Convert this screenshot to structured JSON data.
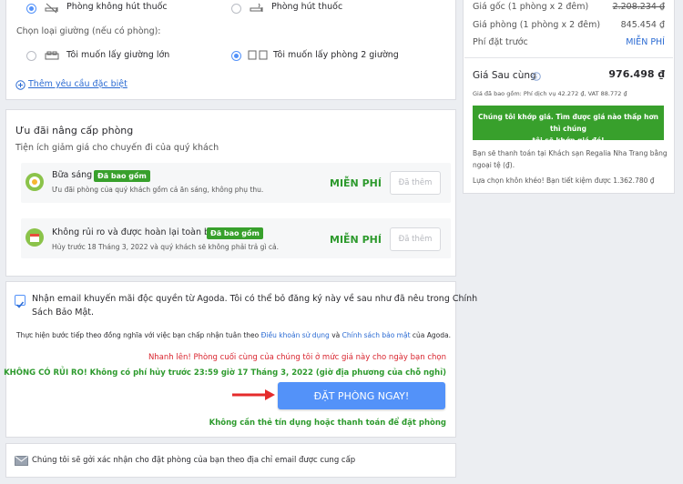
{
  "room_prefs": {
    "smoking_options": [
      {
        "label": "Phòng không hút thuốc",
        "selected": true
      },
      {
        "label": "Phòng hút thuốc",
        "selected": false
      }
    ],
    "bed_title": "Chọn loại giường (nếu có phòng):",
    "bed_options": [
      {
        "label": "Tôi muốn lấy giường lớn",
        "selected": false
      },
      {
        "label": "Tôi muốn lấy phòng 2 giường",
        "selected": true
      }
    ],
    "special_request": "Thêm yêu cầu đặc biệt"
  },
  "upgrades": {
    "title": "Ưu đãi nâng cấp phòng",
    "subtitle": "Tiện ích giảm giá cho chuyến đi của quý khách",
    "items": [
      {
        "name": "Bữa sáng",
        "badge": "Đã bao gồm",
        "desc": "Ưu đãi phòng của quý khách gồm cả ăn sáng, không phụ thu.",
        "price": "MIỄN PHÍ",
        "button": "Đã thêm"
      },
      {
        "name": "Không rủi ro và được hoàn lại toàn bộ",
        "badge": "Đã bao gồm",
        "desc": "Hủy trước 18 Tháng 3, 2022 và quý khách sẽ không phải trả gì cả.",
        "price": "MIỄN PHÍ",
        "button": "Đã thêm"
      }
    ]
  },
  "consent": {
    "email_opt_in_line1": "Nhận email khuyến mãi độc quyền từ Agoda. Tôi có thể bỏ đăng ký này về sau như đã nêu trong Chính",
    "email_opt_in_line2": "Sách Bảo Mật.",
    "terms_prefix": "Thực hiện bước tiếp theo đồng nghĩa với việc bạn chấp nhận tuân theo",
    "terms_link": "Điều khoản sử dụng",
    "terms_and": "và",
    "privacy_link": "Chính sách bảo mật",
    "terms_suffix": "của Agoda.",
    "urgency": "Nhanh lên! Phòng cuối cùng của chúng tôi ở mức giá này cho ngày bạn chọn",
    "no_risk": "KHÔNG CÓ RỦI RO! Không có phí hủy trước 23:59 giờ 17 Tháng 3, 2022 (giờ địa phương của chỗ nghỉ)",
    "book_button": "ĐẶT PHÒNG NGAY!",
    "no_card": "Không cần thẻ tín dụng hoặc thanh toán để đặt phòng"
  },
  "email_notice": "Chúng tôi sẽ gởi xác nhận cho đặt phòng của bạn theo địa chỉ email được cung cấp",
  "price_summary": {
    "rows": [
      {
        "label": "Giá gốc (1 phòng x 2 đêm)",
        "value": "2.208.234 ₫",
        "strike": true
      },
      {
        "label": "Giá phòng (1 phòng x 2 đêm)",
        "value": "845.454 ₫",
        "strike": false
      },
      {
        "label": "Phí đặt trước",
        "value": "MIỄN PHÍ",
        "strike": false
      }
    ],
    "final_label": "Giá Sau cùng",
    "final_value": "976.498 ₫",
    "includes": "Giá đã bao gồm: Phí dịch vụ 42.272 ₫, VAT 88.772 ₫",
    "guarantee_line1": "Chúng tôi khớp giá. Tìm được giá nào thấp hơn thì chúng",
    "guarantee_line2": "tôi sẽ khớp giá đó!",
    "pay_note_line1": "Bạn sẽ thanh toán tại Khách sạn Regalia Nha Trang bằng",
    "pay_note_line2": "ngoại tệ (₫).",
    "savings": "Lựa chọn khôn khéo! Bạn tiết kiệm được 1.362.780 ₫"
  },
  "colors": {
    "accent": "#5392f9",
    "green": "#38a02c",
    "red": "#d9242e",
    "link": "#2b6bd3"
  }
}
